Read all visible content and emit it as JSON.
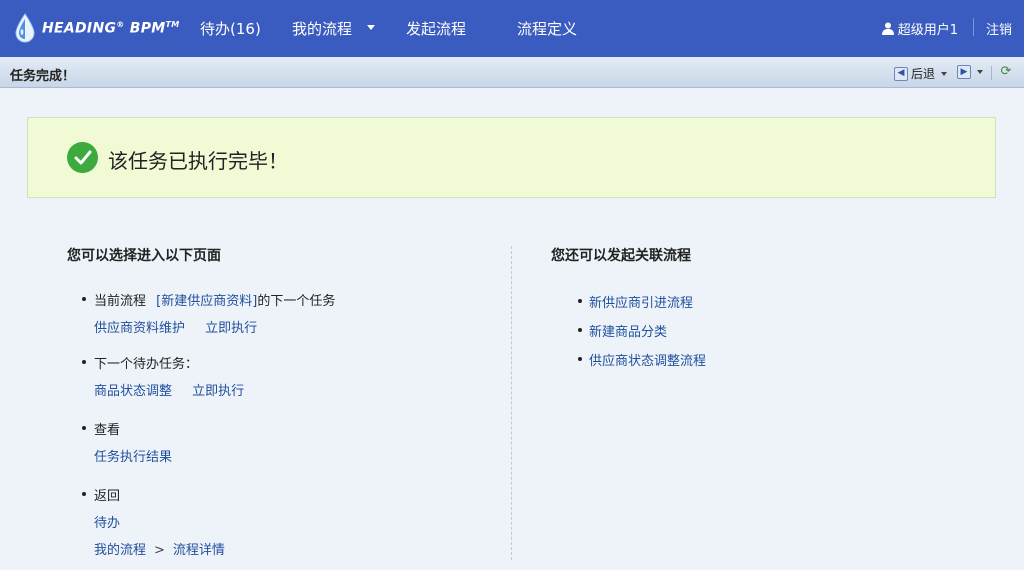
{
  "header": {
    "logo_text": "HEADING",
    "logo_reg": "®",
    "logo_bpm": "BPM",
    "logo_tm": "TM",
    "nav": [
      {
        "label": "待办(16)"
      },
      {
        "label": "我的流程"
      },
      {
        "label": "发起流程"
      },
      {
        "label": "流程定义"
      }
    ],
    "user_label": "超级用户1",
    "logout_label": "注销"
  },
  "subbar": {
    "title": "任务完成！",
    "back_label": "后退",
    "icons": [
      "back-arrow-icon",
      "forward-arrow-icon",
      "refresh-icon"
    ]
  },
  "success": {
    "message": "该任务已执行完毕！",
    "icon": "checkmark-icon",
    "bg_color": "#f0fad5"
  },
  "left": {
    "title": "您可以选择进入以下页面",
    "current_flow": {
      "prefix": "当前流程",
      "flow_link": "[新建供应商资料]",
      "suffix": "的下一个任务",
      "task_link": "供应商资料维护",
      "run_link": "立即执行"
    },
    "next_todo": {
      "label": "下一个待办任务：",
      "task_link": "商品状态调整",
      "run_link": "立即执行"
    },
    "view": {
      "label": "查看",
      "result_link": "任务执行结果"
    },
    "back": {
      "label": "返回",
      "todo_link": "待办",
      "my_flow_link": "我的流程",
      "arrow": ">",
      "detail_link": "流程详情"
    }
  },
  "right": {
    "title": "您还可以发起关联流程",
    "items": [
      {
        "label": "新供应商引进流程"
      },
      {
        "label": "新建商品分类"
      },
      {
        "label": "供应商状态调整流程"
      }
    ]
  },
  "colors": {
    "header_bg": "#3a5bbf",
    "link": "#1f4f9c",
    "success_green": "#3daa3d"
  }
}
